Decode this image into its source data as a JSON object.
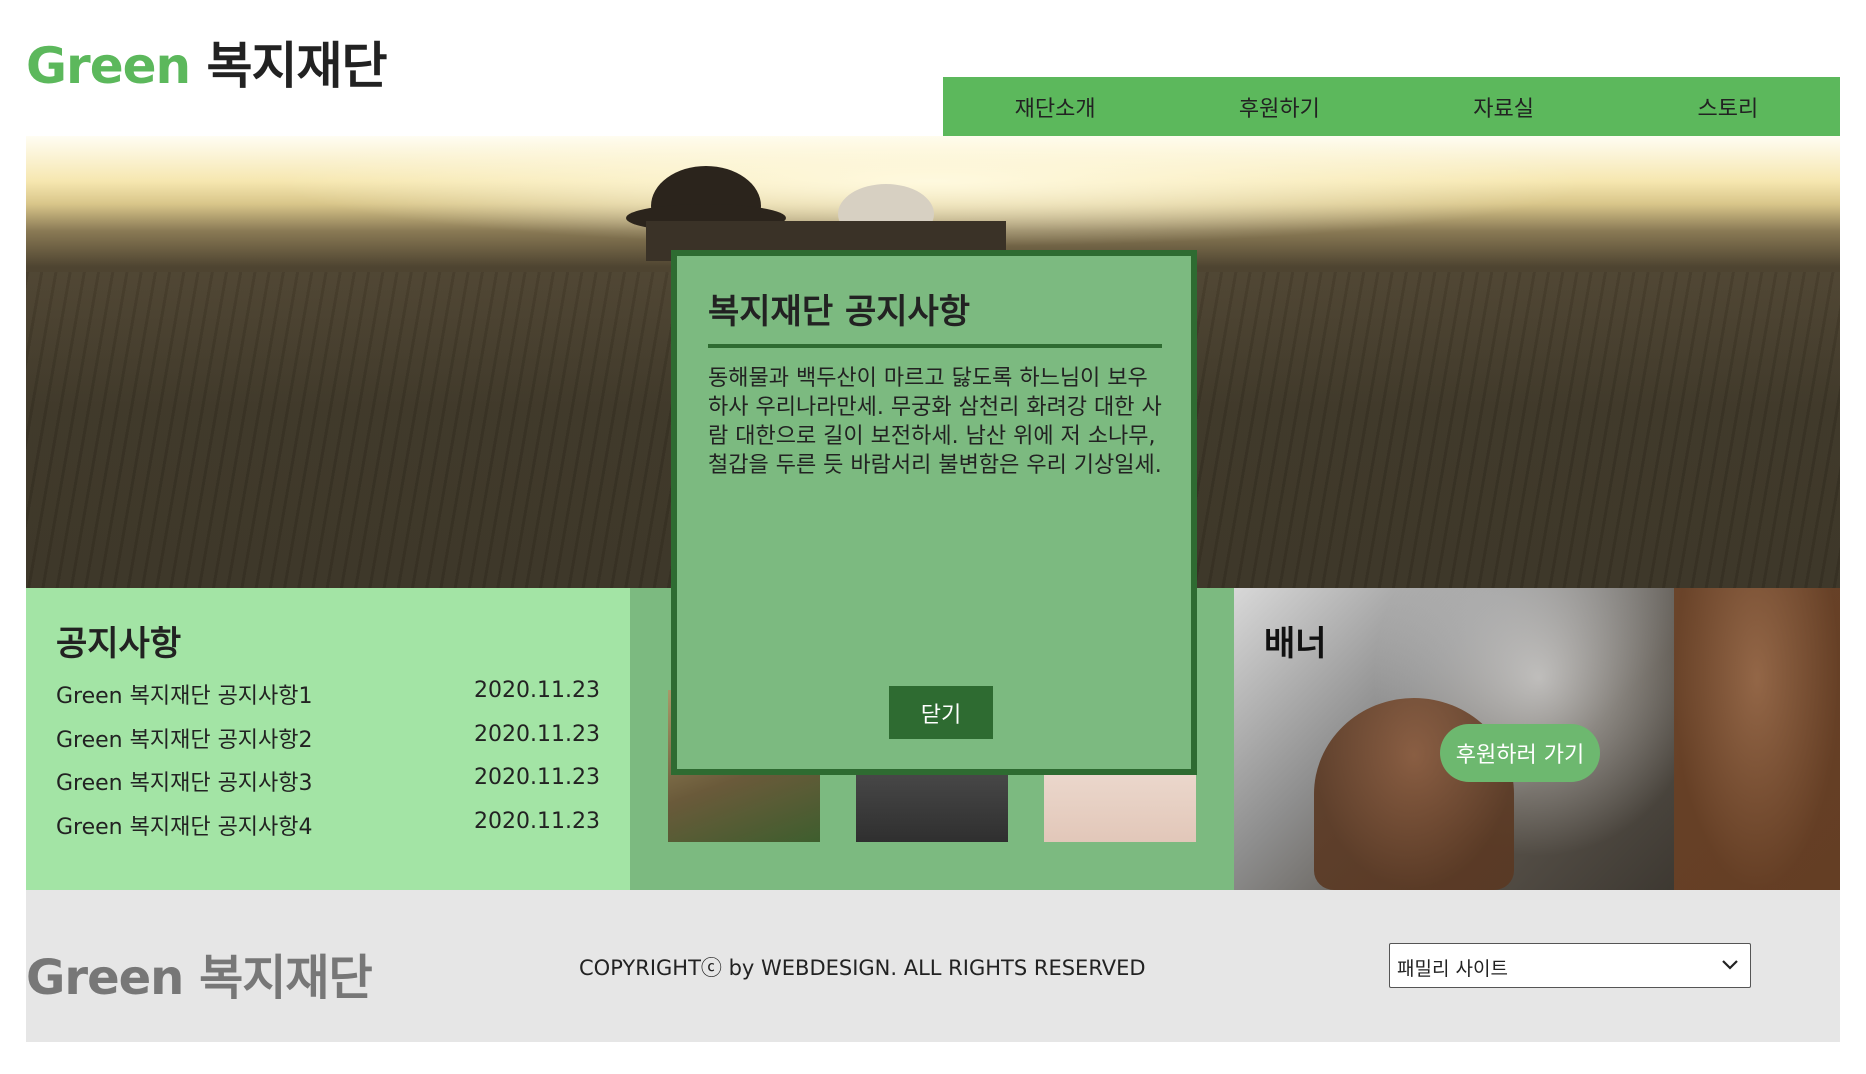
{
  "header": {
    "logo_en": "Green",
    "logo_ko": "복지재단",
    "nav": [
      "재단소개",
      "후원하기",
      "자료실",
      "스토리"
    ]
  },
  "notice_panel": {
    "title": "공지사항",
    "items": [
      {
        "title": "Green 복지재단 공지사항1",
        "date": "2020.11.23"
      },
      {
        "title": "Green 복지재단 공지사항2",
        "date": "2020.11.23"
      },
      {
        "title": "Green 복지재단 공지사항3",
        "date": "2020.11.23"
      },
      {
        "title": "Green 복지재단 공지사항4",
        "date": "2020.11.23"
      }
    ]
  },
  "banner_panel": {
    "title": "배너",
    "button": "후원하러 가기"
  },
  "footer": {
    "logo_en": "Green",
    "logo_ko": "복지재단",
    "copyright": "COPYRIGHTⓒ by WEBDESIGN. ALL RIGHTS RESERVED",
    "family_site": "패밀리 사이트"
  },
  "modal": {
    "title": "복지재단 공지사항",
    "body": "동해물과 백두산이 마르고 닳도록 하느님이 보우하사 우리나라만세. 무궁화 삼천리 화려강 대한 사람 대한으로 길이 보전하세. 남산 위에 저 소나무, 철갑을 두른 듯 바람서리 불변함은 우리 기상일세.",
    "close": "닫기"
  },
  "colors": {
    "brand_green": "#5cb85c",
    "notice_bg": "#a3e4a5",
    "gallery_bg": "#7cba80",
    "modal_border": "#2e6b31",
    "footer_bg": "#e6e6e6"
  },
  "icons": {
    "family_select": "chevron-down-icon"
  }
}
